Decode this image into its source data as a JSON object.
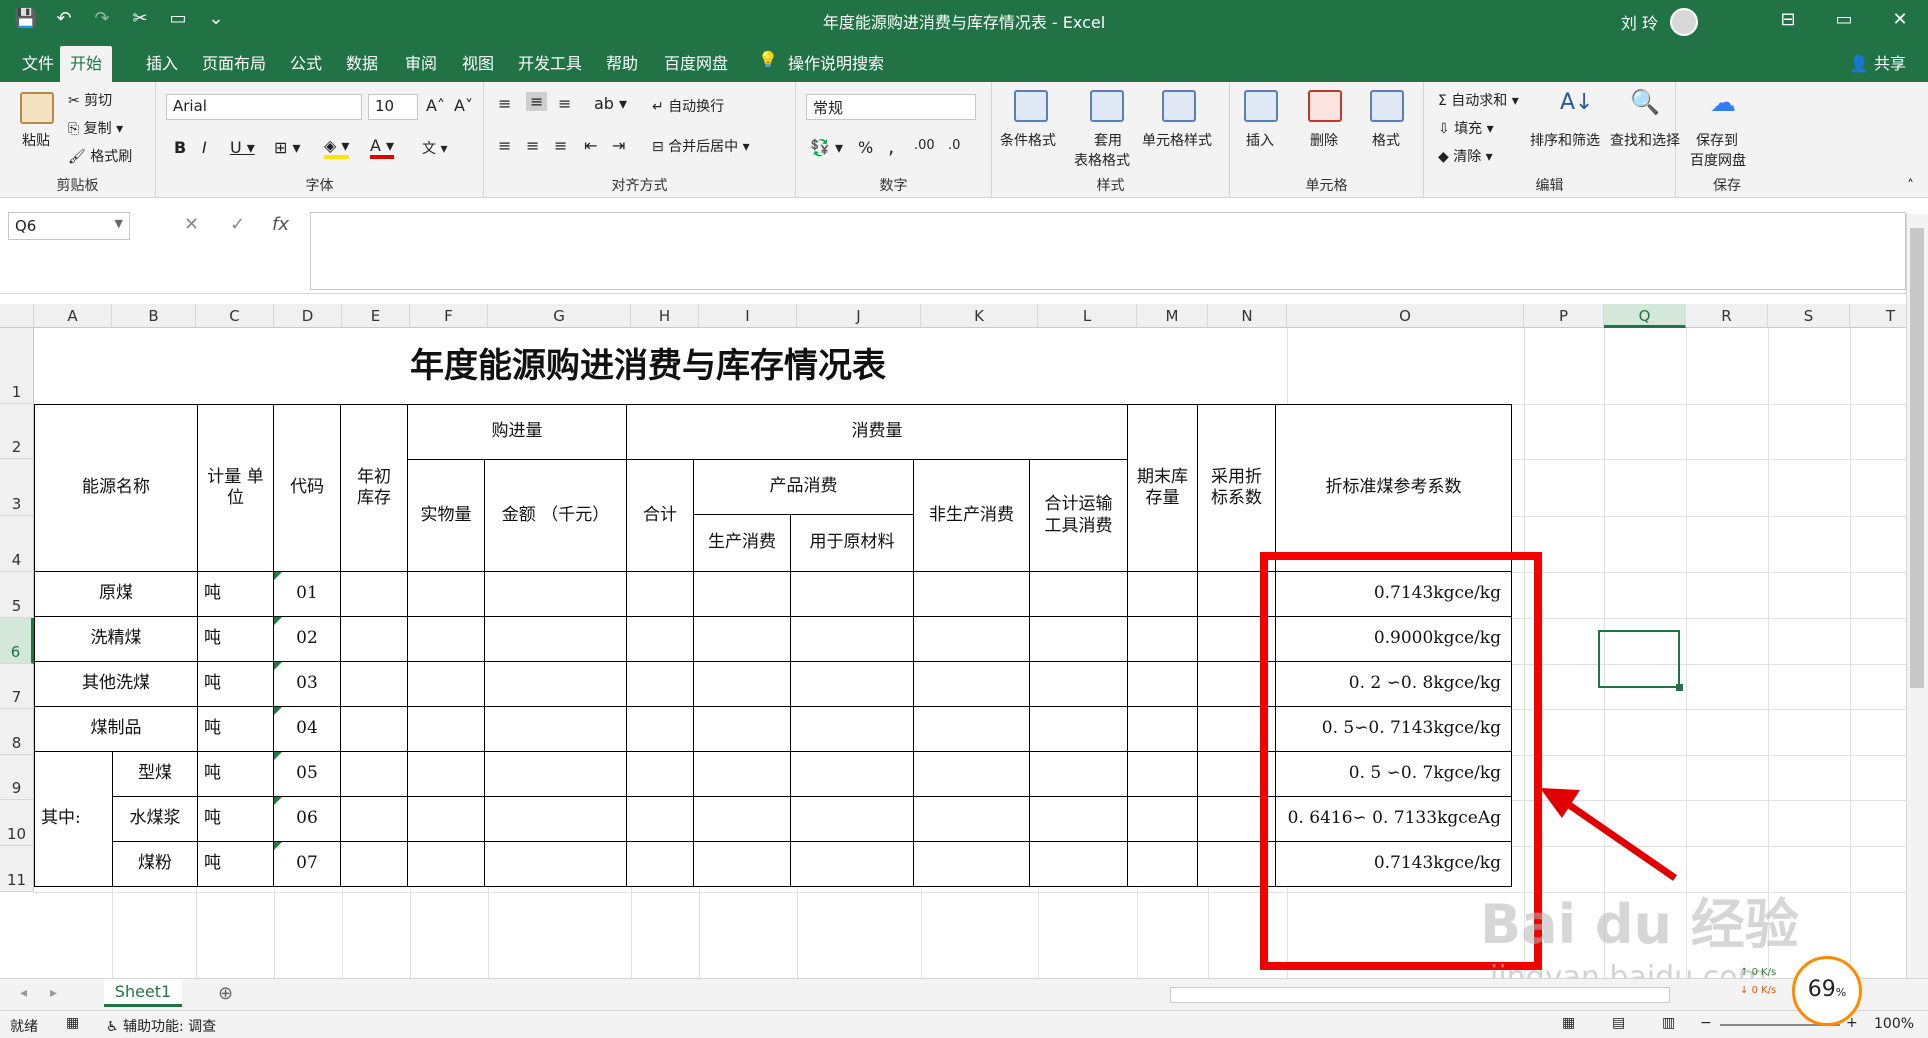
{
  "window": {
    "title": "年度能源购进消费与库存情况表 - Excel",
    "user": "刘 玲",
    "controls": [
      "⊟",
      "▭",
      "✕"
    ]
  },
  "qat": [
    "💾",
    "↶",
    "↷",
    "✂",
    "▭",
    "⌄"
  ],
  "tabs": [
    "文件",
    "开始",
    "插入",
    "页面布局",
    "公式",
    "数据",
    "审阅",
    "视图",
    "开发工具",
    "帮助",
    "百度网盘",
    "操作说明搜索"
  ],
  "share": "共享",
  "ribbon": {
    "clipboard": {
      "paste": "粘贴",
      "cut": "剪切",
      "copy": "复制",
      "format_painter": "格式刷",
      "label": "剪贴板"
    },
    "font": {
      "name": "Arial",
      "size": "10",
      "label": "字体",
      "wen": "文"
    },
    "alignment": {
      "wrap": "自动换行",
      "merge": "合并后居中",
      "label": "对齐方式"
    },
    "number": {
      "format": "常规",
      "percent": "%",
      "comma": ",",
      "label": "数字"
    },
    "styles": {
      "conditional": "条件格式",
      "table_top": "套用",
      "table_bottom": "表格格式",
      "cell_styles": "单元格样式",
      "label": "样式"
    },
    "cells": {
      "insert": "插入",
      "delete": "删除",
      "format": "格式",
      "label": "单元格"
    },
    "editing": {
      "autosum": "自动求和",
      "fill": "填充",
      "clear": "清除",
      "sort": "排序和筛选",
      "find": "查找和选择",
      "label": "编辑"
    },
    "save": {
      "line1": "保存到",
      "line2": "百度网盘",
      "label": "保存"
    }
  },
  "formula_bar": {
    "name_box": "Q6",
    "cancel": "✕",
    "enter": "✓",
    "fx": "fx",
    "value": ""
  },
  "columns": [
    "A",
    "B",
    "C",
    "D",
    "E",
    "F",
    "G",
    "H",
    "I",
    "J",
    "K",
    "L",
    "M",
    "N",
    "O",
    "P",
    "Q",
    "R",
    "S",
    "T"
  ],
  "rows": [
    "1",
    "2",
    "3",
    "4",
    "5",
    "6",
    "7",
    "8",
    "9",
    "10",
    "11"
  ],
  "sheet": {
    "title": "年度能源购进消费与库存情况表",
    "headers": {
      "energy_name": "能源名称",
      "unit": "计量 单位",
      "code": "代码",
      "opening_stock": "年初库存",
      "purchase": "购进量",
      "physical_qty": "实物量",
      "amount": "金额 （千元）",
      "consumption": "消费量",
      "total": "合计",
      "product_consumption": "产品消费",
      "production": "生产消费",
      "raw_material": "用于原材料",
      "non_production": "非生产消费",
      "transport": "合计运输工具消费",
      "closing_stock": "期末库存量",
      "conversion": "采用折标系数",
      "reference_coef": "折标准煤参考系数"
    },
    "rows": [
      {
        "name": "原煤",
        "unit": "吨",
        "code": "01",
        "coef": "0.7143kgce/kg"
      },
      {
        "name": "洗精煤",
        "unit": "吨",
        "code": "02",
        "coef": "0.9000kgce/kg"
      },
      {
        "name": "其他洗煤",
        "unit": "吨",
        "code": "03",
        "coef": "0. 2 ∽0. 8kgce/kg"
      },
      {
        "name": "煤制品",
        "unit": "吨",
        "code": "04",
        "coef": "0. 5∽0. 7143kgce/kg"
      },
      {
        "name": "型煤",
        "unit": "吨",
        "code": "05",
        "coef": "0. 5 ∽0. 7kgce/kg"
      },
      {
        "name": "水煤浆",
        "unit": "吨",
        "code": "06",
        "coef": "0. 6416∽ 0. 7133kgceAg"
      },
      {
        "name": "煤粉",
        "unit": "吨",
        "code": "07",
        "coef": "0.7143kgce/kg"
      }
    ],
    "among": "其中:"
  },
  "sheet_tab": "Sheet1",
  "status": {
    "ready": "就绪",
    "accessibility": "辅助功能: 调查",
    "zoom": "100%"
  },
  "speed": {
    "value": "69",
    "unit": "%",
    "up": "0 K/s",
    "down": "0 K/s"
  },
  "watermark": {
    "line1": "Bai du 经验",
    "line2": "jingyan.baidu.com"
  },
  "colors": {
    "excel_green": "#217346",
    "highlight": "#f50000"
  }
}
